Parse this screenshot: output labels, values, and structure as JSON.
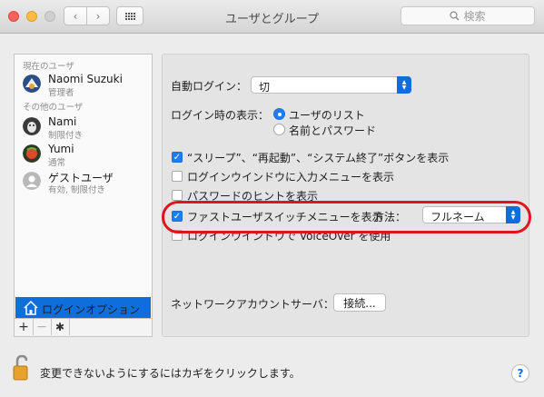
{
  "window": {
    "title": "ユーザとグループ",
    "search_placeholder": "検索"
  },
  "sidebar": {
    "current_header": "現在のユーザ",
    "other_header": "その他のユーザ",
    "current_user": {
      "name": "Naomi Suzuki",
      "role": "管理者"
    },
    "other_users": [
      {
        "name": "Nami",
        "role": "制限付き"
      },
      {
        "name": "Yumi",
        "role": "通常"
      },
      {
        "name": "ゲストユーザ",
        "role": "有効, 制限付き"
      }
    ],
    "login_options_label": "ログインオプション",
    "tools": {
      "add": "+",
      "remove": "−",
      "gear": "✱"
    }
  },
  "panel": {
    "auto_login_label": "自動ログイン：",
    "auto_login_value": "切",
    "login_display_label": "ログイン時の表示：",
    "login_display_options": [
      "ユーザのリスト",
      "名前とパスワード"
    ],
    "login_display_selected": 0,
    "checkboxes": [
      {
        "label": "“スリープ”、“再起動”、“システム終了”ボタンを表示",
        "checked": true
      },
      {
        "label": "ログインウインドウに入力メニューを表示",
        "checked": false
      },
      {
        "label": "パスワードのヒントを表示",
        "checked": false
      },
      {
        "label": "ファストユーザスイッチメニューを表示",
        "checked": true
      },
      {
        "label": "ログインウインドウで VoiceOver を使用",
        "checked": false
      }
    ],
    "method_label": "方法：",
    "method_value": "フルネーム",
    "network_label": "ネットワークアカウントサーバ：",
    "connect_button": "接続..."
  },
  "footer": {
    "lock_text": "変更できないようにするにはカギをクリックします。",
    "help": "?"
  },
  "colors": {
    "accent": "#0e6edb",
    "highlight_ring": "#e0141e"
  }
}
